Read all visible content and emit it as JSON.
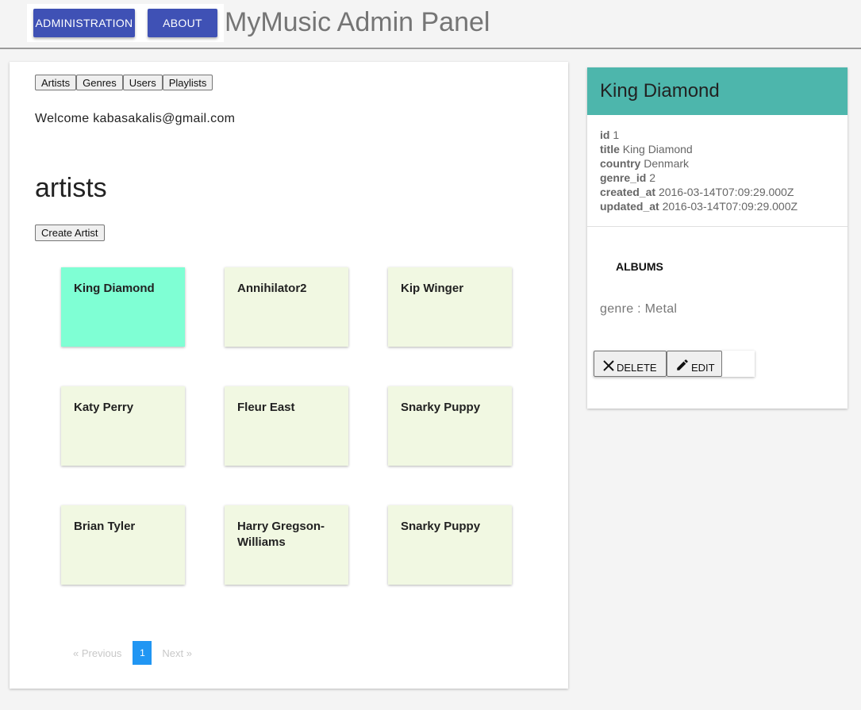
{
  "topbar": {
    "admin_label": "ADMINISTRATION",
    "about_label": "ABOUT",
    "title": "MyMusic Admin Panel"
  },
  "tabs": [
    "Artists",
    "Genres",
    "Users",
    "Playlists"
  ],
  "welcome": "Welcome kabasakalis@gmail.com",
  "section_title": "artists",
  "create_label": "Create Artist",
  "artists": [
    "King Diamond",
    "Annihilator2",
    "Kip Winger",
    "Katy Perry",
    "Fleur East",
    "Snarky Puppy",
    "Brian Tyler",
    "Harry Gregson-Williams",
    "Snarky Puppy"
  ],
  "selected_index": 0,
  "pager": {
    "prev": "«  Previous",
    "page": "1",
    "next": "Next  »"
  },
  "detail": {
    "name": "King Diamond",
    "fields": [
      {
        "key": "id",
        "value": "1"
      },
      {
        "key": "title",
        "value": "King Diamond"
      },
      {
        "key": "country",
        "value": "Denmark"
      },
      {
        "key": "genre_id",
        "value": "2"
      },
      {
        "key": "created_at",
        "value": "2016-03-14T07:09:29.000Z"
      },
      {
        "key": "updated_at",
        "value": "2016-03-14T07:09:29.000Z"
      }
    ],
    "albums_label": "ALBUMS",
    "genre_text": "genre : Metal",
    "delete_label": "DELETE",
    "edit_label": "EDIT",
    "delete_icon": "close-icon",
    "edit_icon": "pencil-icon"
  },
  "colors": {
    "accent": "#3f51b5",
    "header_teal": "#4db6ac",
    "selected_card": "#7fffd4",
    "card": "#f1f8e2",
    "page_active": "#2196f3"
  }
}
